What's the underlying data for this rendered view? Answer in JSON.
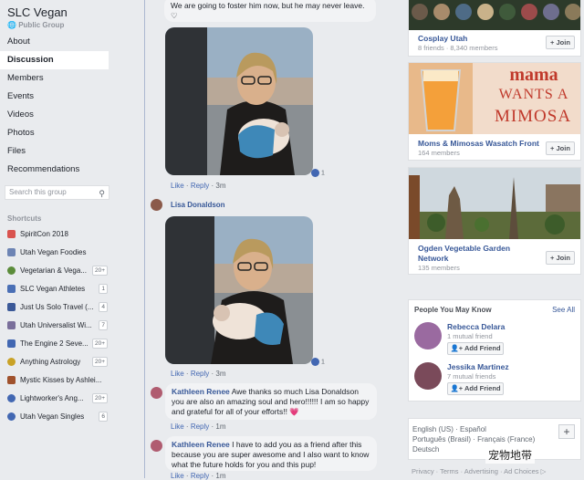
{
  "group": {
    "title": "SLC Vegan",
    "subtitle": "Public Group"
  },
  "nav": [
    "About",
    "Discussion",
    "Members",
    "Events",
    "Videos",
    "Photos",
    "Files",
    "Recommendations"
  ],
  "search": {
    "placeholder": "Search this group"
  },
  "shortcuts": {
    "heading": "Shortcuts",
    "items": [
      {
        "label": "SpiritCon 2018",
        "badge": "",
        "color": "#d9534f"
      },
      {
        "label": "Utah Vegan Foodies",
        "badge": "",
        "color": "#6d84b4"
      },
      {
        "label": "Vegetarian & Vega...",
        "badge": "20+",
        "color": "#5b8c3a"
      },
      {
        "label": "SLC Vegan Athletes",
        "badge": "1",
        "color": "#4a6fb5"
      },
      {
        "label": "Just Us Solo Travel (...",
        "badge": "4",
        "color": "#3b5998"
      },
      {
        "label": "Utah Universalist Wi...",
        "badge": "7",
        "color": "#7a6f9b"
      },
      {
        "label": "The Engine 2 Seve...",
        "badge": "20+",
        "color": "#4267b2"
      },
      {
        "label": "Anything Astrology",
        "badge": "20+",
        "color": "#c9a227"
      },
      {
        "label": "Mystic Kisses by Ashlei...",
        "badge": "",
        "color": "#a0522d"
      },
      {
        "label": "Lightworker's Ang...",
        "badge": "20+",
        "color": "#4267b2"
      },
      {
        "label": "Utah Vegan Singles",
        "badge": "6",
        "color": "#4267b2"
      }
    ]
  },
  "feed": {
    "top_comment": "We are going to foster him now, but he may never leave. ♡",
    "actions": {
      "like": "Like",
      "reply": "Reply",
      "sep": "·"
    },
    "reply1": {
      "time": "3m",
      "reactions": "1"
    },
    "lisa_name": "Lisa Donaldson",
    "reply2": {
      "time": "3m",
      "reactions": "1"
    },
    "kathleen1": {
      "name": "Kathleen Renee",
      "text": "Awe thanks so much Lisa Donaldson you are also an amazing soul and hero!!!!!! I am so happy and grateful for all of your efforts!! 💗",
      "time": "1m"
    },
    "kathleen2": {
      "name": "Kathleen Renee",
      "text": "I have to add you as a friend after this because you are super awesome and I also want to know what the future holds for you and this pup!",
      "time": "1m"
    }
  },
  "suggested_groups": [
    {
      "name": "Cosplay Utah",
      "meta": "8 friends · 8,340 members",
      "join": "+ Join"
    },
    {
      "name": "Moms & Mimosas Wasatch Front",
      "meta": "164 members",
      "join": "+ Join",
      "banner_top": "mama",
      "banner_mid": "WANTS A",
      "banner_bot": "MIMOSA"
    },
    {
      "name": "Ogden Vegetable Garden Network",
      "name_l1": "Ogden Vegetable Garden",
      "name_l2": "Network",
      "meta": "135 members",
      "join": "+ Join"
    }
  ],
  "pymk": {
    "heading": "People You May Know",
    "see_all": "See All",
    "people": [
      {
        "name": "Rebecca Delara",
        "mutual": "1 mutual friend",
        "button": "Add Friend"
      },
      {
        "name": "Jessika Martinez",
        "mutual": "7 mutual friends",
        "button": "Add Friend"
      }
    ]
  },
  "languages": {
    "line1": "English (US) · Español",
    "line2": "Português (Brasil) · Français (France)",
    "line3": "Deutsch",
    "plus": "+"
  },
  "footer": "Privacy · Terms · Advertising · Ad Choices ▷",
  "watermark": "宠物地带",
  "colors": {
    "link": "#385898",
    "accent": "#4267b2",
    "bg": "#e9ebee"
  }
}
